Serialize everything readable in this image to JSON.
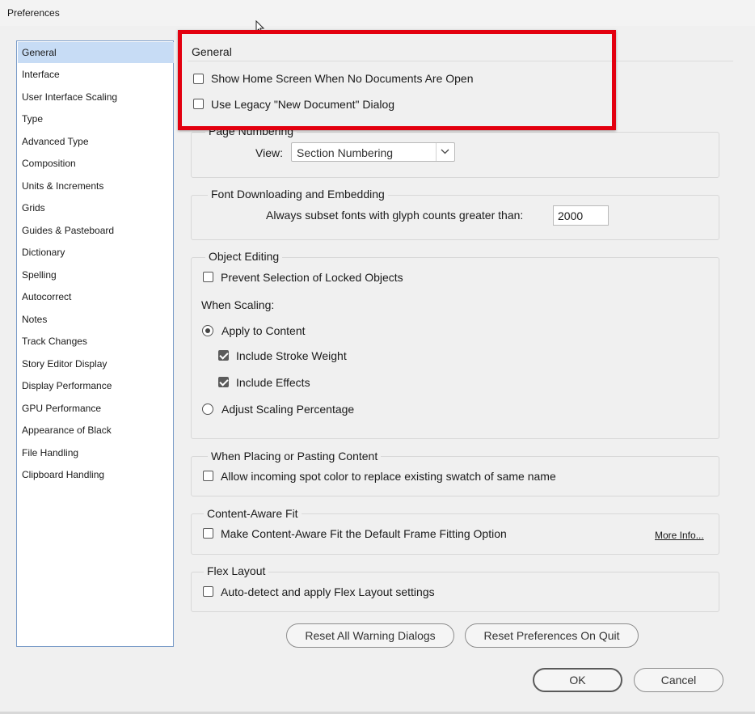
{
  "window": {
    "title": "Preferences"
  },
  "categories": [
    {
      "label": "General",
      "selected": true
    },
    {
      "label": "Interface"
    },
    {
      "label": "User Interface Scaling"
    },
    {
      "label": "Type"
    },
    {
      "label": "Advanced Type"
    },
    {
      "label": "Composition"
    },
    {
      "label": "Units & Increments"
    },
    {
      "label": "Grids"
    },
    {
      "label": "Guides & Pasteboard"
    },
    {
      "label": "Dictionary"
    },
    {
      "label": "Spelling"
    },
    {
      "label": "Autocorrect"
    },
    {
      "label": "Notes"
    },
    {
      "label": "Track Changes"
    },
    {
      "label": "Story Editor Display"
    },
    {
      "label": "Display Performance"
    },
    {
      "label": "GPU Performance"
    },
    {
      "label": "Appearance of Black"
    },
    {
      "label": "File Handling"
    },
    {
      "label": "Clipboard Handling"
    }
  ],
  "general": {
    "title": "General",
    "show_home_screen": {
      "label": "Show Home Screen When No Documents Are Open",
      "checked": false
    },
    "legacy_new_document": {
      "label": "Use Legacy \"New Document\" Dialog",
      "checked": false
    }
  },
  "page_numbering": {
    "title": "Page Numbering",
    "view_label": "View:",
    "view_value": "Section Numbering"
  },
  "font_downloading": {
    "title": "Font Downloading and Embedding",
    "subset_label": "Always subset fonts with glyph counts greater than:",
    "subset_value": "2000"
  },
  "object_editing": {
    "title": "Object Editing",
    "prevent_selection": {
      "label": "Prevent Selection of Locked Objects",
      "checked": false
    },
    "when_scaling": "When Scaling:",
    "apply_to_content": {
      "label": "Apply to Content",
      "selected": true
    },
    "include_stroke": {
      "label": "Include Stroke Weight",
      "checked": true
    },
    "include_effects": {
      "label": "Include Effects",
      "checked": true
    },
    "adjust_scaling": {
      "label": "Adjust Scaling Percentage",
      "selected": false
    }
  },
  "placing": {
    "title": "When Placing or Pasting Content",
    "spot_color": {
      "label": "Allow incoming spot color to replace existing swatch of same name",
      "checked": false
    }
  },
  "content_aware": {
    "title": "Content-Aware Fit",
    "default_option": {
      "label": "Make Content-Aware Fit the Default Frame Fitting Option",
      "checked": false
    },
    "more_info": "More Info..."
  },
  "flex_layout": {
    "title": "Flex Layout",
    "auto_detect": {
      "label": "Auto-detect and apply Flex Layout settings",
      "checked": false
    }
  },
  "buttons": {
    "reset_warnings": "Reset All Warning Dialogs",
    "reset_prefs": "Reset Preferences On Quit",
    "ok": "OK",
    "cancel": "Cancel"
  },
  "colors": {
    "highlight": "#e3000f",
    "selection": "#c7dcf5"
  }
}
